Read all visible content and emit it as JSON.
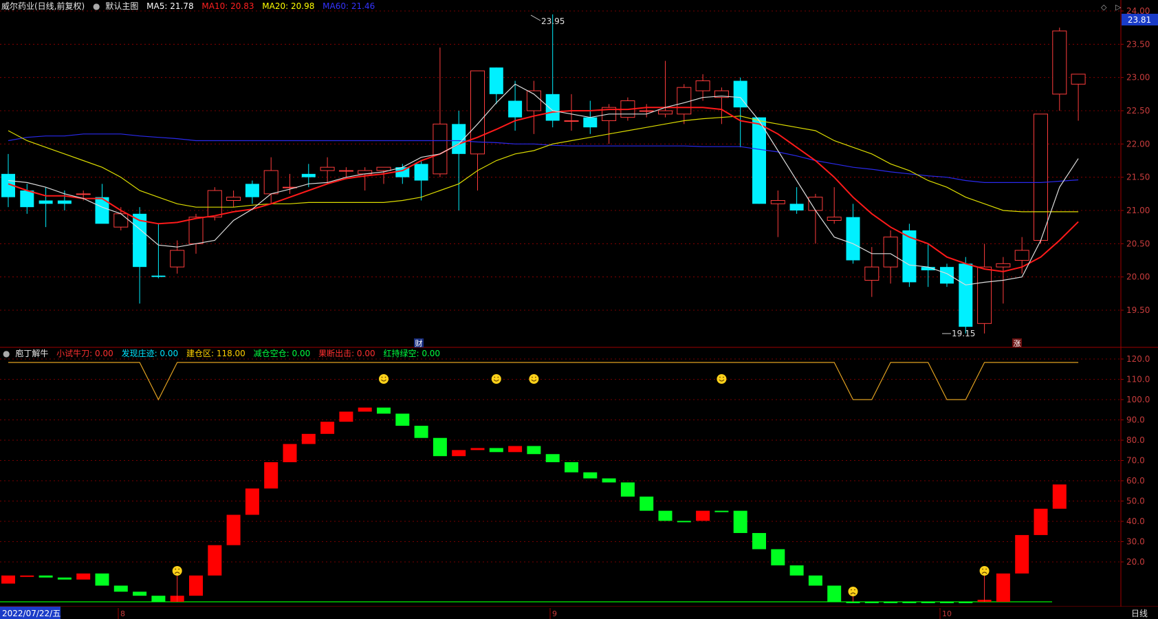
{
  "main_header": {
    "stock": "威尔药业(日线,前复权)",
    "chart_name": "默认主图",
    "ma": [
      {
        "label": "MA5: 21.78",
        "color": "#ffffff"
      },
      {
        "label": "MA10: 20.83",
        "color": "#ff2020"
      },
      {
        "label": "MA20: 20.98",
        "color": "#ffff00"
      },
      {
        "label": "MA60: 21.46",
        "color": "#3333ff"
      }
    ]
  },
  "current_price": "23.81",
  "price_axis_labels": [
    "24.00",
    "23.50",
    "23.00",
    "22.50",
    "22.00",
    "21.50",
    "21.00",
    "20.50",
    "20.00",
    "19.50"
  ],
  "high_annotation": "23.95",
  "low_annotation": "19.15",
  "markers": {
    "cai": "财",
    "zhang": "涨"
  },
  "indicator_header": {
    "name": "庖丁解牛",
    "items": [
      {
        "label": "小试牛刀: 0.00",
        "color": "#ff3030"
      },
      {
        "label": "发现庄迹: 0.00",
        "color": "#00e5ff"
      },
      {
        "label": "建仓区: 118.00",
        "color": "#ffd000"
      },
      {
        "label": "减仓空仓: 0.00",
        "color": "#00ff40"
      },
      {
        "label": "果断出击: 0.00",
        "color": "#ff3030"
      },
      {
        "label": "红持绿空: 0.00",
        "color": "#00ff40"
      }
    ]
  },
  "indicator_axis_labels": [
    "120.0",
    "110.0",
    "100.0",
    "90.0",
    "80.0",
    "70.0",
    "60.0",
    "50.0",
    "40.0",
    "30.0",
    "20.0"
  ],
  "date_axis": {
    "start": "2022/07/22/五",
    "months": [
      "8",
      "9",
      "10"
    ],
    "period": "日线"
  },
  "colors": {
    "up": "#ff3c3c",
    "down": "#00f0ff",
    "ind_up": "#ff0000",
    "ind_down": "#00ff20",
    "grid": "#a00000",
    "axis_text": "#c83c3c"
  },
  "chart_data": {
    "type": "candlestick",
    "ylim": [
      19.0,
      24.0
    ],
    "candles": [
      {
        "o": 21.55,
        "h": 21.85,
        "l": 21.05,
        "c": 21.2
      },
      {
        "o": 21.3,
        "h": 21.4,
        "l": 20.95,
        "c": 21.05
      },
      {
        "o": 21.15,
        "h": 21.35,
        "l": 20.75,
        "c": 21.1
      },
      {
        "o": 21.15,
        "h": 21.3,
        "l": 21.0,
        "c": 21.1
      },
      {
        "o": 21.25,
        "h": 21.3,
        "l": 21.15,
        "c": 21.25
      },
      {
        "o": 21.2,
        "h": 21.4,
        "l": 20.9,
        "c": 20.8
      },
      {
        "o": 20.75,
        "h": 21.05,
        "l": 20.7,
        "c": 20.95
      },
      {
        "o": 20.95,
        "h": 21.05,
        "l": 19.6,
        "c": 20.15
      },
      {
        "o": 20.02,
        "h": 20.8,
        "l": 19.98,
        "c": 20.0
      },
      {
        "o": 20.15,
        "h": 20.55,
        "l": 20.05,
        "c": 20.4
      },
      {
        "o": 20.5,
        "h": 20.95,
        "l": 20.35,
        "c": 20.9
      },
      {
        "o": 20.9,
        "h": 21.35,
        "l": 20.85,
        "c": 21.3
      },
      {
        "o": 21.15,
        "h": 21.3,
        "l": 21.05,
        "c": 21.2
      },
      {
        "o": 21.4,
        "h": 21.45,
        "l": 21.1,
        "c": 21.2
      },
      {
        "o": 21.25,
        "h": 21.8,
        "l": 21.1,
        "c": 21.6
      },
      {
        "o": 21.35,
        "h": 21.55,
        "l": 21.25,
        "c": 21.35
      },
      {
        "o": 21.55,
        "h": 21.7,
        "l": 21.35,
        "c": 21.5
      },
      {
        "o": 21.6,
        "h": 21.8,
        "l": 21.4,
        "c": 21.65
      },
      {
        "o": 21.6,
        "h": 21.65,
        "l": 21.5,
        "c": 21.6
      },
      {
        "o": 21.55,
        "h": 21.65,
        "l": 21.3,
        "c": 21.6
      },
      {
        "o": 21.6,
        "h": 21.65,
        "l": 21.4,
        "c": 21.65
      },
      {
        "o": 21.65,
        "h": 21.7,
        "l": 21.4,
        "c": 21.5
      },
      {
        "o": 21.7,
        "h": 21.75,
        "l": 21.15,
        "c": 21.45
      },
      {
        "o": 21.55,
        "h": 23.45,
        "l": 21.5,
        "c": 22.3
      },
      {
        "o": 22.3,
        "h": 22.5,
        "l": 21.0,
        "c": 21.85
      },
      {
        "o": 21.85,
        "h": 23.1,
        "l": 21.3,
        "c": 23.1
      },
      {
        "o": 23.15,
        "h": 23.15,
        "l": 22.6,
        "c": 22.75
      },
      {
        "o": 22.65,
        "h": 22.95,
        "l": 22.2,
        "c": 22.4
      },
      {
        "o": 22.5,
        "h": 22.95,
        "l": 22.15,
        "c": 22.8
      },
      {
        "o": 22.75,
        "h": 23.95,
        "l": 22.25,
        "c": 22.35
      },
      {
        "o": 22.35,
        "h": 22.75,
        "l": 22.2,
        "c": 22.35
      },
      {
        "o": 22.4,
        "h": 22.65,
        "l": 22.15,
        "c": 22.25
      },
      {
        "o": 22.35,
        "h": 22.6,
        "l": 22.0,
        "c": 22.55
      },
      {
        "o": 22.4,
        "h": 22.7,
        "l": 22.35,
        "c": 22.65
      },
      {
        "o": 22.5,
        "h": 22.6,
        "l": 22.4,
        "c": 22.5
      },
      {
        "o": 22.45,
        "h": 23.25,
        "l": 22.4,
        "c": 22.5
      },
      {
        "o": 22.45,
        "h": 22.9,
        "l": 22.3,
        "c": 22.85
      },
      {
        "o": 22.8,
        "h": 23.05,
        "l": 22.65,
        "c": 22.95
      },
      {
        "o": 22.7,
        "h": 22.85,
        "l": 22.3,
        "c": 22.8
      },
      {
        "o": 22.95,
        "h": 23.0,
        "l": 21.95,
        "c": 22.55
      },
      {
        "o": 22.4,
        "h": 22.4,
        "l": 21.1,
        "c": 21.1
      },
      {
        "o": 21.1,
        "h": 21.3,
        "l": 20.6,
        "c": 21.15
      },
      {
        "o": 21.1,
        "h": 21.35,
        "l": 20.95,
        "c": 21.0
      },
      {
        "o": 21.0,
        "h": 21.25,
        "l": 20.5,
        "c": 21.2
      },
      {
        "o": 20.85,
        "h": 21.35,
        "l": 20.8,
        "c": 20.9
      },
      {
        "o": 20.9,
        "h": 21.1,
        "l": 20.2,
        "c": 20.25
      },
      {
        "o": 19.95,
        "h": 20.45,
        "l": 19.7,
        "c": 20.15
      },
      {
        "o": 20.15,
        "h": 20.7,
        "l": 19.9,
        "c": 20.6
      },
      {
        "o": 20.7,
        "h": 20.8,
        "l": 19.85,
        "c": 19.92
      },
      {
        "o": 20.15,
        "h": 20.5,
        "l": 19.85,
        "c": 20.1
      },
      {
        "o": 20.15,
        "h": 20.2,
        "l": 19.85,
        "c": 19.9
      },
      {
        "o": 20.2,
        "h": 20.3,
        "l": 19.15,
        "c": 19.25
      },
      {
        "o": 19.3,
        "h": 20.5,
        "l": 19.15,
        "c": 20.15
      },
      {
        "o": 20.15,
        "h": 20.3,
        "l": 19.6,
        "c": 20.2
      },
      {
        "o": 20.25,
        "h": 20.6,
        "l": 20.05,
        "c": 20.4
      },
      {
        "o": 20.55,
        "h": 22.45,
        "l": 20.5,
        "c": 22.45
      },
      {
        "o": 22.75,
        "h": 23.75,
        "l": 22.5,
        "c": 23.7
      },
      {
        "o": 22.9,
        "h": 23.05,
        "l": 22.35,
        "c": 23.05
      }
    ],
    "ma5": [
      21.45,
      21.42,
      21.35,
      21.25,
      21.18,
      21.05,
      20.95,
      20.72,
      20.48,
      20.45,
      20.5,
      20.55,
      20.85,
      21.02,
      21.25,
      21.32,
      21.4,
      21.42,
      21.5,
      21.55,
      21.58,
      21.65,
      21.8,
      21.85,
      22.0,
      22.3,
      22.62,
      22.9,
      22.75,
      22.5,
      22.45,
      22.4,
      22.45,
      22.45,
      22.45,
      22.55,
      22.62,
      22.7,
      22.72,
      22.7,
      22.35,
      21.9,
      21.45,
      21.0,
      20.6,
      20.5,
      20.35,
      20.35,
      20.18,
      20.15,
      20.05,
      19.88,
      19.92,
      19.95,
      20.0,
      20.55,
      21.35,
      21.78
    ],
    "ma10": [
      21.4,
      21.3,
      21.22,
      21.22,
      21.18,
      21.18,
      21.0,
      20.85,
      20.8,
      20.82,
      20.88,
      20.92,
      20.98,
      21.02,
      21.1,
      21.2,
      21.3,
      21.4,
      21.48,
      21.52,
      21.55,
      21.6,
      21.75,
      21.85,
      22.0,
      22.1,
      22.22,
      22.35,
      22.42,
      22.48,
      22.5,
      22.5,
      22.52,
      22.52,
      22.55,
      22.55,
      22.55,
      22.55,
      22.52,
      22.35,
      22.3,
      22.15,
      21.95,
      21.75,
      21.5,
      21.2,
      20.95,
      20.75,
      20.6,
      20.5,
      20.3,
      20.2,
      20.12,
      20.08,
      20.15,
      20.3,
      20.55,
      20.83
    ],
    "ma20": [
      22.2,
      22.05,
      21.95,
      21.85,
      21.75,
      21.65,
      21.5,
      21.3,
      21.2,
      21.1,
      21.05,
      21.05,
      21.05,
      21.08,
      21.1,
      21.1,
      21.12,
      21.12,
      21.12,
      21.12,
      21.12,
      21.15,
      21.2,
      21.3,
      21.4,
      21.6,
      21.75,
      21.85,
      21.9,
      22.0,
      22.05,
      22.1,
      22.15,
      22.2,
      22.25,
      22.3,
      22.35,
      22.38,
      22.4,
      22.42,
      22.35,
      22.3,
      22.25,
      22.2,
      22.05,
      21.95,
      21.85,
      21.7,
      21.6,
      21.45,
      21.35,
      21.2,
      21.1,
      21.0,
      20.98,
      20.98,
      20.98,
      20.98
    ],
    "ma60": [
      22.05,
      22.1,
      22.12,
      22.12,
      22.15,
      22.15,
      22.15,
      22.12,
      22.1,
      22.08,
      22.05,
      22.05,
      22.05,
      22.05,
      22.05,
      22.05,
      22.05,
      22.05,
      22.05,
      22.05,
      22.05,
      22.05,
      22.05,
      22.05,
      22.05,
      22.03,
      22.02,
      22.0,
      22.0,
      21.98,
      21.97,
      21.97,
      21.97,
      21.97,
      21.97,
      21.97,
      21.97,
      21.96,
      21.96,
      21.96,
      21.92,
      21.88,
      21.82,
      21.75,
      21.7,
      21.65,
      21.62,
      21.58,
      21.55,
      21.52,
      21.5,
      21.45,
      21.42,
      21.42,
      21.42,
      21.42,
      21.44,
      21.46
    ],
    "indicator": {
      "ylim": [
        0,
        128
      ],
      "line_118": [
        118,
        118,
        118,
        118,
        118,
        118,
        118,
        118,
        100,
        118,
        118,
        118,
        118,
        118,
        118,
        118,
        118,
        118,
        118,
        118,
        118,
        118,
        118,
        118,
        118,
        118,
        118,
        118,
        118,
        118,
        118,
        118,
        118,
        118,
        118,
        118,
        118,
        118,
        118,
        118,
        118,
        118,
        118,
        118,
        118,
        100,
        100,
        118,
        118,
        118,
        100,
        100,
        118,
        118,
        118,
        118,
        118,
        118
      ],
      "bars": [
        {
          "o": 13,
          "c": 9,
          "t": "r"
        },
        {
          "o": 13,
          "c": 13,
          "t": "r"
        },
        {
          "o": 13,
          "c": 12,
          "t": "g"
        },
        {
          "o": 12,
          "c": 11,
          "t": "g"
        },
        {
          "o": 11,
          "c": 14,
          "t": "r"
        },
        {
          "o": 14,
          "c": 8,
          "t": "g"
        },
        {
          "o": 8,
          "c": 5,
          "t": "g"
        },
        {
          "o": 5,
          "c": 3,
          "t": "g"
        },
        {
          "o": 3,
          "c": 0,
          "t": "g"
        },
        {
          "o": 0,
          "c": 3,
          "t": "r"
        },
        {
          "o": 3,
          "c": 13,
          "t": "r"
        },
        {
          "o": 13,
          "c": 28,
          "t": "r"
        },
        {
          "o": 28,
          "c": 43,
          "t": "r"
        },
        {
          "o": 43,
          "c": 56,
          "t": "r"
        },
        {
          "o": 56,
          "c": 69,
          "t": "r"
        },
        {
          "o": 69,
          "c": 78,
          "t": "r"
        },
        {
          "o": 78,
          "c": 83,
          "t": "r"
        },
        {
          "o": 83,
          "c": 89,
          "t": "r"
        },
        {
          "o": 89,
          "c": 94,
          "t": "r"
        },
        {
          "o": 94,
          "c": 96,
          "t": "r"
        },
        {
          "o": 96,
          "c": 93,
          "t": "g"
        },
        {
          "o": 93,
          "c": 87,
          "t": "g"
        },
        {
          "o": 87,
          "c": 81,
          "t": "g"
        },
        {
          "o": 81,
          "c": 72,
          "t": "g"
        },
        {
          "o": 72,
          "c": 75,
          "t": "r"
        },
        {
          "o": 75,
          "c": 76,
          "t": "r"
        },
        {
          "o": 76,
          "c": 74,
          "t": "g"
        },
        {
          "o": 74,
          "c": 77,
          "t": "r"
        },
        {
          "o": 77,
          "c": 73,
          "t": "g"
        },
        {
          "o": 73,
          "c": 69,
          "t": "g"
        },
        {
          "o": 69,
          "c": 64,
          "t": "g"
        },
        {
          "o": 64,
          "c": 61,
          "t": "g"
        },
        {
          "o": 61,
          "c": 59,
          "t": "g"
        },
        {
          "o": 59,
          "c": 52,
          "t": "g"
        },
        {
          "o": 52,
          "c": 45,
          "t": "g"
        },
        {
          "o": 45,
          "c": 40,
          "t": "g"
        },
        {
          "o": 40,
          "c": 40,
          "t": "g"
        },
        {
          "o": 40,
          "c": 45,
          "t": "r"
        },
        {
          "o": 45,
          "c": 45,
          "t": "g"
        },
        {
          "o": 45,
          "c": 34,
          "t": "g"
        },
        {
          "o": 34,
          "c": 26,
          "t": "g"
        },
        {
          "o": 26,
          "c": 18,
          "t": "g"
        },
        {
          "o": 18,
          "c": 13,
          "t": "g"
        },
        {
          "o": 13,
          "c": 8,
          "t": "g"
        },
        {
          "o": 8,
          "c": 0,
          "t": "g"
        },
        {
          "o": 0,
          "c": 0,
          "t": "g"
        },
        {
          "o": 0,
          "c": 0,
          "t": "g"
        },
        {
          "o": 0,
          "c": 0,
          "t": "g"
        },
        {
          "o": 0,
          "c": 0,
          "t": "g"
        },
        {
          "o": 0,
          "c": 0,
          "t": "g"
        },
        {
          "o": 0,
          "c": 0,
          "t": "g"
        },
        {
          "o": 0,
          "c": 0,
          "t": "g"
        },
        {
          "o": 0,
          "c": 1,
          "t": "r"
        },
        {
          "o": 0,
          "c": 14,
          "t": "r"
        },
        {
          "o": 14,
          "c": 33,
          "t": "r"
        },
        {
          "o": 33,
          "c": 46,
          "t": "r"
        },
        {
          "o": 46,
          "c": 58,
          "t": "r"
        }
      ],
      "smile_idx": [
        20,
        26,
        28,
        38
      ],
      "frown_idx": [
        9,
        45,
        52
      ]
    }
  }
}
